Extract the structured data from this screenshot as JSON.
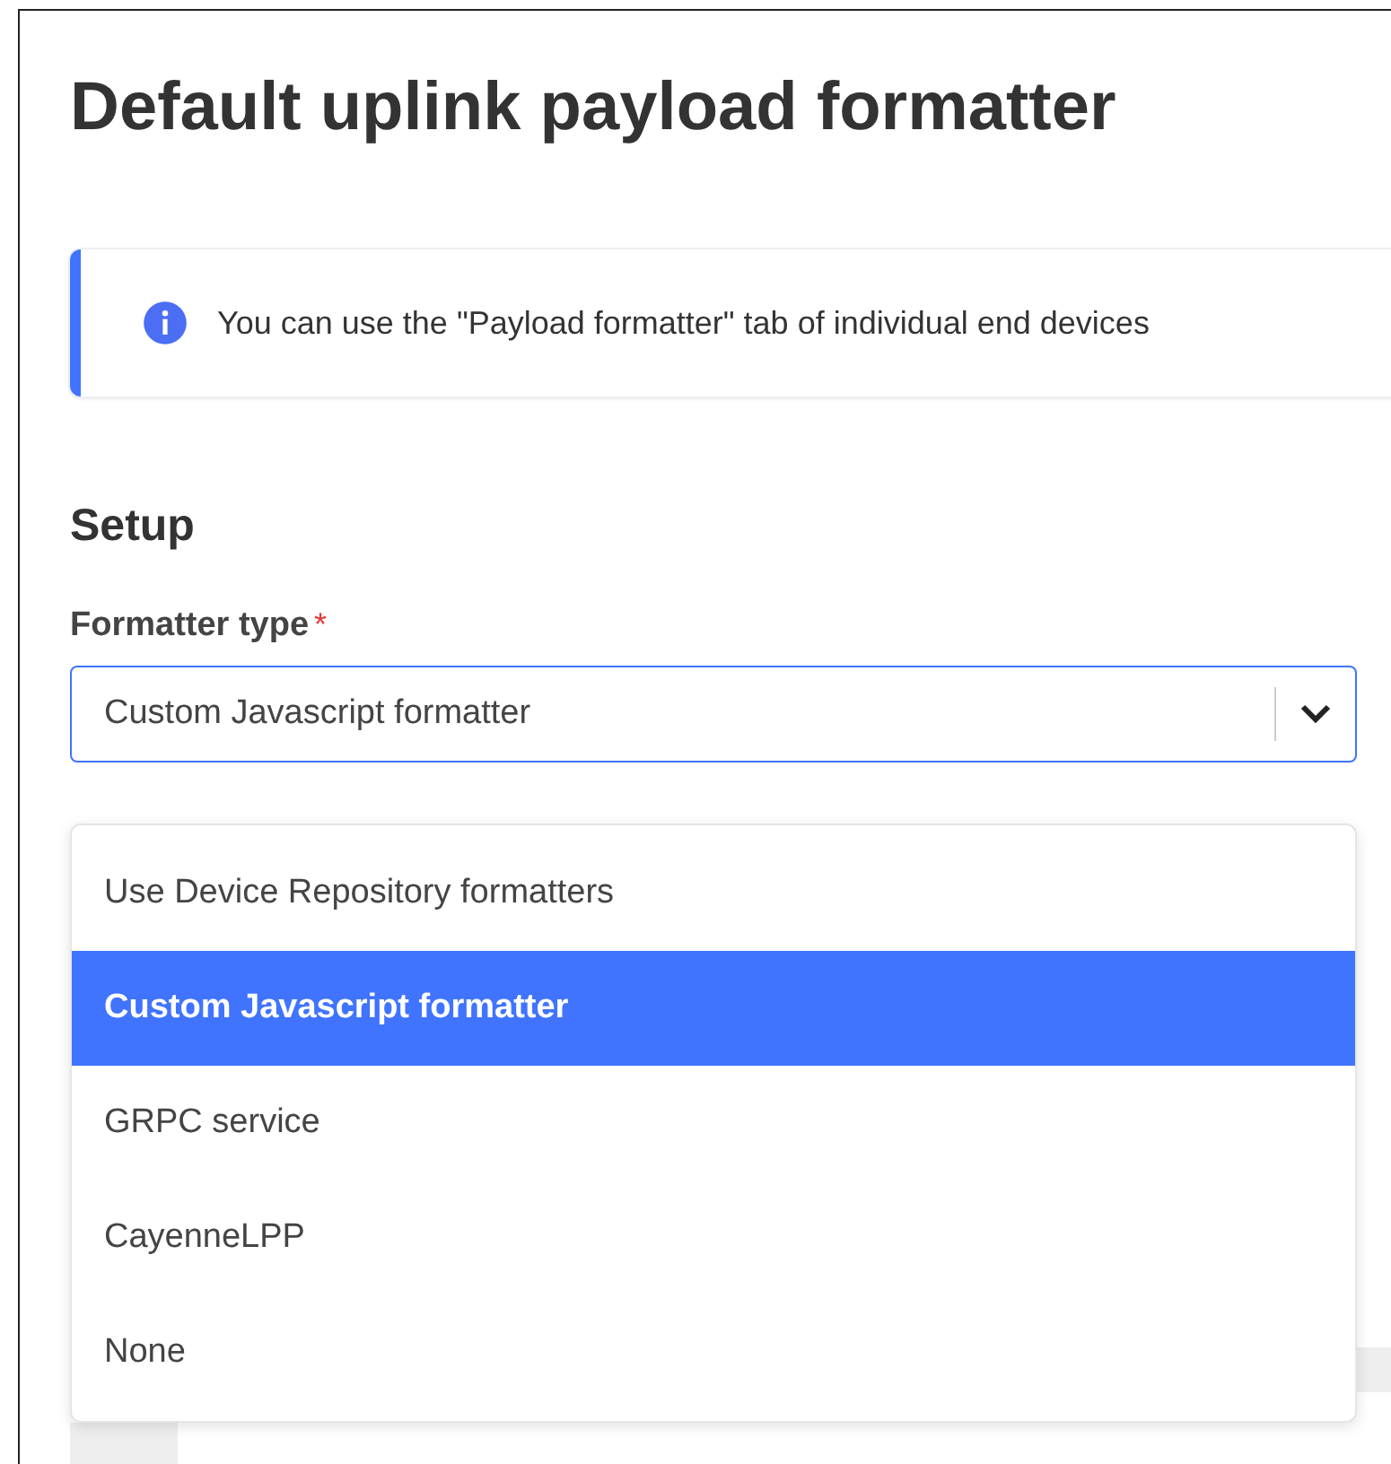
{
  "title": "Default uplink payload formatter",
  "notice": {
    "text": "You can use the \"Payload formatter\" tab of individual end devices"
  },
  "section": {
    "title": "Setup"
  },
  "field": {
    "label": "Formatter type",
    "required_mark": "*",
    "value": "Custom Javascript formatter",
    "expanded": true
  },
  "options": [
    {
      "label": "Use Device Repository formatters",
      "selected": false
    },
    {
      "label": "Custom Javascript formatter",
      "selected": true
    },
    {
      "label": "GRPC service",
      "selected": false
    },
    {
      "label": "CayenneLPP",
      "selected": false
    },
    {
      "label": "None",
      "selected": false
    }
  ]
}
